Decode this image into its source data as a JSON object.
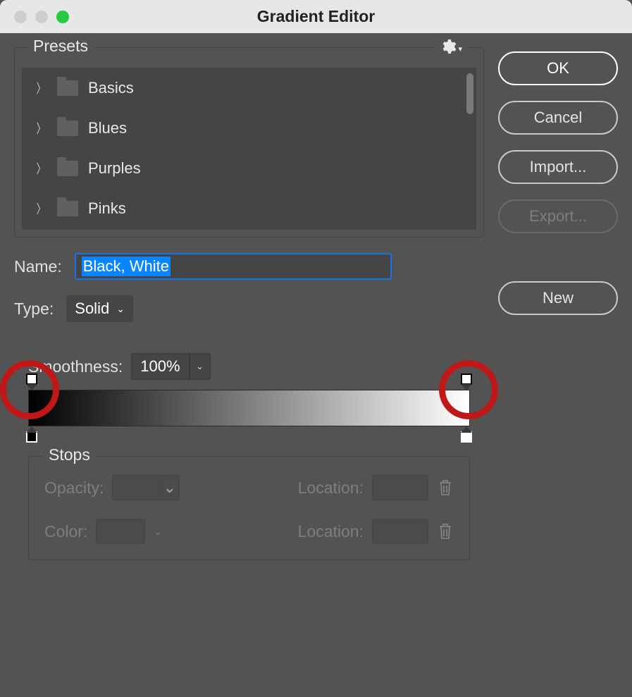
{
  "window": {
    "title": "Gradient Editor"
  },
  "presets": {
    "legend": "Presets",
    "items": [
      {
        "label": "Basics"
      },
      {
        "label": "Blues"
      },
      {
        "label": "Purples"
      },
      {
        "label": "Pinks"
      }
    ]
  },
  "name": {
    "label": "Name:",
    "value": "Black, White"
  },
  "type": {
    "label": "Type:",
    "value": "Solid"
  },
  "smoothness": {
    "label": "Smoothness:",
    "value": "100%"
  },
  "gradient": {
    "opacity_stops": [
      {
        "position": 0,
        "color": "#ffffff"
      },
      {
        "position": 100,
        "color": "#ffffff"
      }
    ],
    "color_stops": [
      {
        "position": 0,
        "color": "#000000"
      },
      {
        "position": 100,
        "color": "#ffffff"
      }
    ]
  },
  "stops": {
    "legend": "Stops",
    "opacity_label": "Opacity:",
    "color_label": "Color:",
    "location_label": "Location:"
  },
  "buttons": {
    "ok": "OK",
    "cancel": "Cancel",
    "import": "Import...",
    "export": "Export...",
    "new": "New"
  }
}
